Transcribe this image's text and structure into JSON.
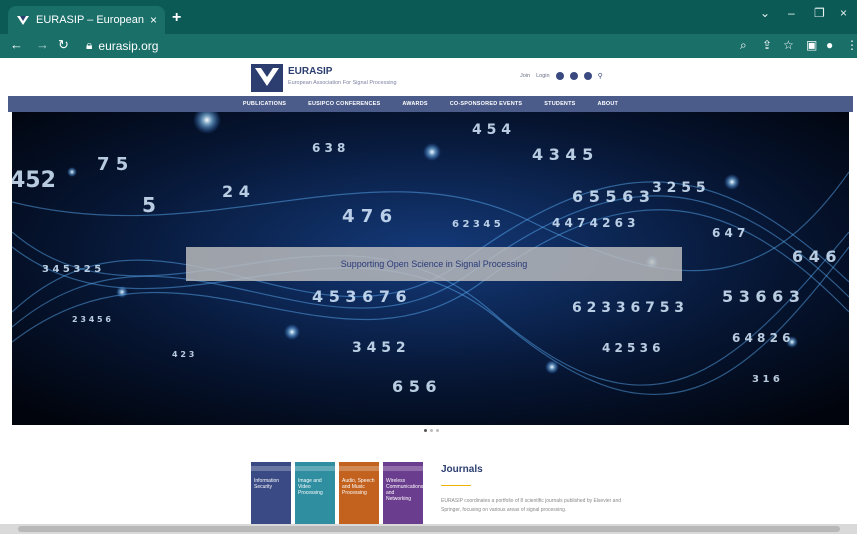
{
  "browser": {
    "tab_title": "EURASIP – European Association",
    "tab_close": "×",
    "new_tab": "+",
    "url": "eurasip.org",
    "win_min": "–",
    "win_max": "❐",
    "win_close": "×"
  },
  "header": {
    "logo_name": "EURASIP",
    "logo_sub": "European Association For Signal Processing",
    "links": [
      "Join",
      "Login"
    ]
  },
  "nav": [
    "PUBLICATIONS",
    "EUSIPCO CONFERENCES",
    "AWARDS",
    "CO-SPONSORED EVENTS",
    "STUDENTS",
    "ABOUT"
  ],
  "hero": {
    "banner": "Supporting Open Science in Signal Processing"
  },
  "journals": {
    "heading": "Journals",
    "description": "EURASIP coordinates a portfolio of 8 scientific journals published by Elsevier and Springer, focusing on various areas of signal processing.",
    "covers": [
      {
        "title": "Information Security",
        "color": "#3a4a85"
      },
      {
        "title": "Image and Video Processing",
        "color": "#2f8ea0"
      },
      {
        "title": "Audio, Speech and Music Processing",
        "color": "#c2621e"
      },
      {
        "title": "Wireless Communications and Networking",
        "color": "#6b3d8e"
      }
    ]
  },
  "colors": {
    "chrome": "#0b5a55",
    "nav": "#4b5b8a",
    "brand": "#2c3e70"
  }
}
